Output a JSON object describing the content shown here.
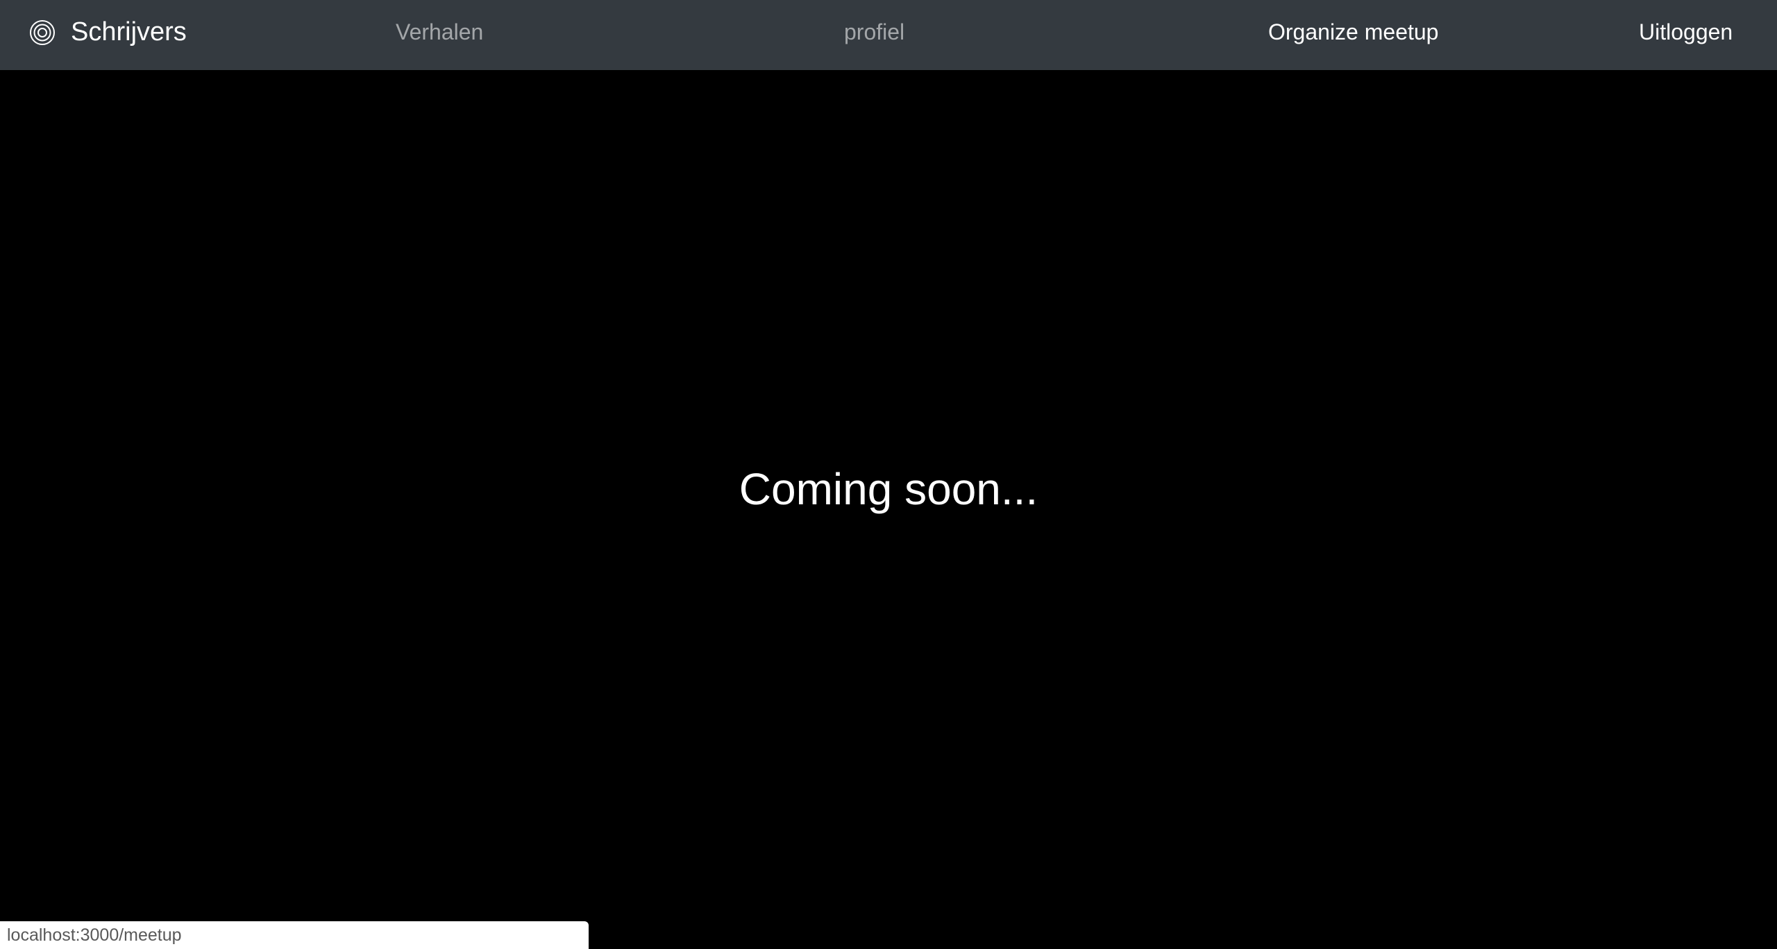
{
  "navbar": {
    "brand": {
      "icon": "concentric-circles-icon",
      "label": "Schrijvers"
    },
    "links": {
      "stories": "Verhalen",
      "profile": "profiel",
      "organize_meetup": "Organize meetup",
      "logout": "Uitloggen"
    },
    "colors": {
      "background": "#343a40",
      "link_muted": "rgba(255,255,255,0.55)",
      "link_active": "#ffffff"
    }
  },
  "main": {
    "heading": "Coming soon...",
    "background": "#000000"
  },
  "status_bar": {
    "url": "localhost:3000/meetup"
  }
}
